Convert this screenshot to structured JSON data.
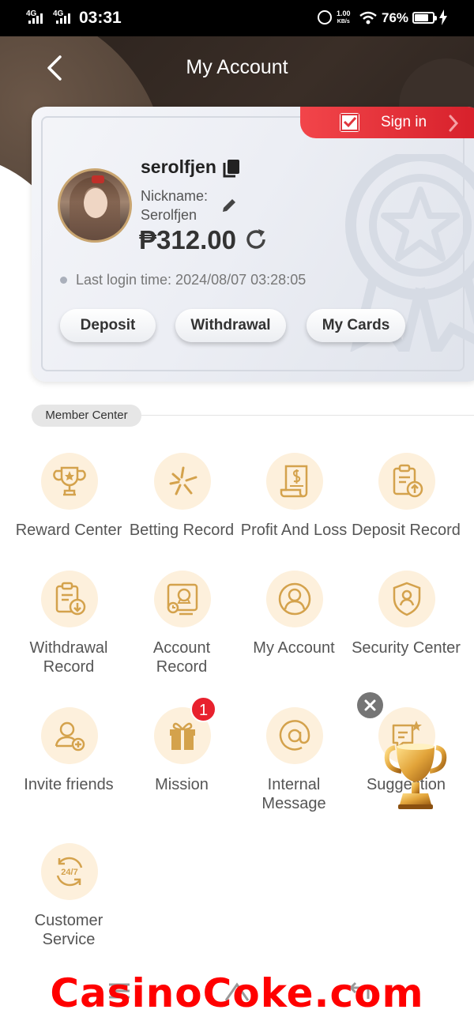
{
  "status_bar": {
    "net1": "4G",
    "net2": "4G",
    "time": "03:31",
    "speed_value": "1.00",
    "speed_unit": "KB/s",
    "battery_text": "76%",
    "battery_level": 0.76
  },
  "header": {
    "title": "My Account",
    "back_icon": "chevron-left-icon"
  },
  "card": {
    "signin_label": "Sign in",
    "username": "serolfjen",
    "nickname_label": "Nickname:",
    "nickname_value": "Serolfjen",
    "balance": "₱312.00",
    "last_login": "Last login time: 2024/08/07 03:28:05",
    "buttons": {
      "deposit": "Deposit",
      "withdrawal": "Withdrawal",
      "my_cards": "My Cards"
    }
  },
  "member_center": {
    "title": "Member Center",
    "items": [
      {
        "label": "Reward Center",
        "icon": "trophy-icon"
      },
      {
        "label": "Betting Record",
        "icon": "sparkle-icon"
      },
      {
        "label": "Profit And Loss",
        "icon": "receipt-icon"
      },
      {
        "label": "Deposit Record",
        "icon": "clipboard-upload-icon"
      },
      {
        "label": "Withdrawal\nRecord",
        "icon": "clipboard-download-icon"
      },
      {
        "label": "Account\nRecord",
        "icon": "account-record-icon"
      },
      {
        "label": "My Account",
        "icon": "user-icon"
      },
      {
        "label": "Security Center",
        "icon": "shield-user-icon"
      },
      {
        "label": "Invite friends",
        "icon": "user-plus-icon"
      },
      {
        "label": "Mission",
        "icon": "gift-icon",
        "badge": "1"
      },
      {
        "label": "Internal\nMessage",
        "icon": "at-icon"
      },
      {
        "label": "Suggestion",
        "icon": "chat-star-icon"
      },
      {
        "label": "Customer\nService",
        "icon": "support-24-7-icon"
      }
    ]
  },
  "watermark": "CasinoCoke.com",
  "colors": {
    "accent_red": "#e8212e",
    "icon_gold": "#d4a24c",
    "icon_bg": "#fdf0dc"
  }
}
